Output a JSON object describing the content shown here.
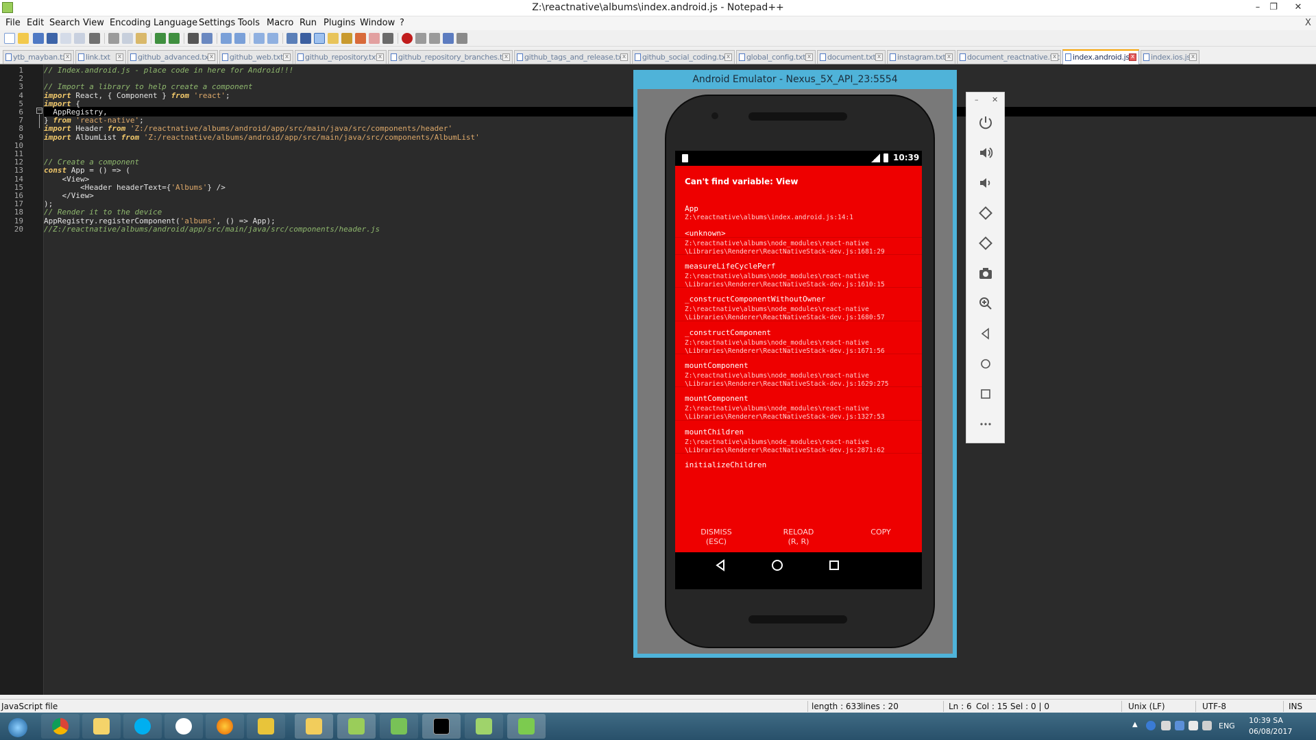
{
  "window": {
    "title": "Z:\\reactnative\\albums\\index.android.js - Notepad++"
  },
  "menu": [
    "File",
    "Edit",
    "Search",
    "View",
    "Encoding",
    "Language",
    "Settings",
    "Tools",
    "Macro",
    "Run",
    "Plugins",
    "Window",
    "?"
  ],
  "menu_close": "X",
  "tabs": [
    {
      "label": "ytb_mayban.txt",
      "active": false
    },
    {
      "label": "link.txt",
      "active": false
    },
    {
      "label": "github_advanced.txt",
      "active": false
    },
    {
      "label": "github_web.txt",
      "active": false
    },
    {
      "label": "github_repository.txt",
      "active": false
    },
    {
      "label": "github_repository_branches.txt",
      "active": false
    },
    {
      "label": "github_tags_and_release.txt",
      "active": false
    },
    {
      "label": "github_social_coding.txt",
      "active": false
    },
    {
      "label": "global_config.txt",
      "active": false
    },
    {
      "label": "document.txt",
      "active": false
    },
    {
      "label": "instagram.txt",
      "active": false
    },
    {
      "label": "document_reactnative.txt",
      "active": false
    },
    {
      "label": "index.android.js",
      "active": true
    },
    {
      "label": "index.ios.js",
      "active": false
    }
  ],
  "editor": {
    "current_line": 6,
    "lines": [
      [
        {
          "t": "// Index.android.js - place code in here for Android!!!",
          "c": "cmt"
        }
      ],
      [],
      [
        {
          "t": "// Import a library to help create a component",
          "c": "cmt"
        }
      ],
      [
        {
          "t": "import",
          "c": "kw"
        },
        {
          "t": " React, { Component } ",
          "c": "pl"
        },
        {
          "t": "from",
          "c": "kw"
        },
        {
          "t": " ",
          "c": "pl"
        },
        {
          "t": "'react'",
          "c": "str"
        },
        {
          "t": ";",
          "c": "pl"
        }
      ],
      [
        {
          "t": "import",
          "c": "kw"
        },
        {
          "t": " {",
          "c": "pl"
        }
      ],
      [
        {
          "t": "  AppRegistry,",
          "c": "pl"
        }
      ],
      [
        {
          "t": "} ",
          "c": "pl"
        },
        {
          "t": "from",
          "c": "kw"
        },
        {
          "t": " ",
          "c": "pl"
        },
        {
          "t": "'react-native'",
          "c": "str"
        },
        {
          "t": ";",
          "c": "pl"
        }
      ],
      [
        {
          "t": "import",
          "c": "kw"
        },
        {
          "t": " Header ",
          "c": "pl"
        },
        {
          "t": "from",
          "c": "kw"
        },
        {
          "t": " ",
          "c": "pl"
        },
        {
          "t": "'Z:/reactnative/albums/android/app/src/main/java/src/components/header'",
          "c": "str"
        }
      ],
      [
        {
          "t": "import",
          "c": "kw"
        },
        {
          "t": " AlbumList ",
          "c": "pl"
        },
        {
          "t": "from",
          "c": "kw"
        },
        {
          "t": " ",
          "c": "pl"
        },
        {
          "t": "'Z:/reactnative/albums/android/app/src/main/java/src/components/AlbumList'",
          "c": "str"
        }
      ],
      [],
      [],
      [
        {
          "t": "// Create a component",
          "c": "cmt"
        }
      ],
      [
        {
          "t": "const",
          "c": "kw"
        },
        {
          "t": " App = () => (",
          "c": "pl"
        }
      ],
      [
        {
          "t": "    <View>",
          "c": "pl"
        }
      ],
      [
        {
          "t": "        <Header headerText={",
          "c": "pl"
        },
        {
          "t": "'Albums'",
          "c": "str"
        },
        {
          "t": "} />",
          "c": "pl"
        }
      ],
      [
        {
          "t": "    </View>",
          "c": "pl"
        }
      ],
      [
        {
          "t": ");",
          "c": "pl"
        }
      ],
      [
        {
          "t": "// Render it to the device",
          "c": "cmt"
        }
      ],
      [
        {
          "t": "AppRegistry.registerComponent(",
          "c": "pl"
        },
        {
          "t": "'albums'",
          "c": "str"
        },
        {
          "t": ", () => App);",
          "c": "pl"
        }
      ],
      [
        {
          "t": "//Z:/reactnative/albums/android/app/src/main/java/src/components/header.js",
          "c": "cmt"
        }
      ]
    ]
  },
  "status": {
    "file_type": "JavaScript file",
    "length": "length : 633",
    "lines": "lines : 20",
    "ln": "Ln : 6",
    "col": "Col : 15",
    "sel": "Sel : 0 | 0",
    "eol": "Unix (LF)",
    "encoding": "UTF-8",
    "mode": "INS"
  },
  "emulator": {
    "title": "Android Emulator - Nexus_5X_API_23:5554",
    "clock": "10:39",
    "error_title": "Can't find variable: View",
    "frames": [
      {
        "fn": "App",
        "file": "Z:\\reactnative\\albums\\index.android.js:14:1"
      },
      {
        "fn": "<unknown>",
        "file": "Z:\\reactnative\\albums\\node_modules\\react-native\n\\Libraries\\Renderer\\ReactNativeStack-dev.js:1681:29"
      },
      {
        "fn": "measureLifeCyclePerf",
        "file": "Z:\\reactnative\\albums\\node_modules\\react-native\n\\Libraries\\Renderer\\ReactNativeStack-dev.js:1610:15"
      },
      {
        "fn": "_constructComponentWithoutOwner",
        "file": "Z:\\reactnative\\albums\\node_modules\\react-native\n\\Libraries\\Renderer\\ReactNativeStack-dev.js:1680:57"
      },
      {
        "fn": "_constructComponent",
        "file": "Z:\\reactnative\\albums\\node_modules\\react-native\n\\Libraries\\Renderer\\ReactNativeStack-dev.js:1671:56"
      },
      {
        "fn": "mountComponent",
        "file": "Z:\\reactnative\\albums\\node_modules\\react-native\n\\Libraries\\Renderer\\ReactNativeStack-dev.js:1629:275"
      },
      {
        "fn": "mountComponent",
        "file": "Z:\\reactnative\\albums\\node_modules\\react-native\n\\Libraries\\Renderer\\ReactNativeStack-dev.js:1327:53"
      },
      {
        "fn": "mountChildren",
        "file": "Z:\\reactnative\\albums\\node_modules\\react-native\n\\Libraries\\Renderer\\ReactNativeStack-dev.js:2871:62"
      },
      {
        "fn": "initializeChildren",
        "file": ""
      }
    ],
    "dismiss": "DISMISS\n(ESC)",
    "reload": "RELOAD\n(R, R)",
    "copy": "COPY"
  },
  "emulator_panel": {
    "icons": [
      "power-icon",
      "volume-up-icon",
      "volume-down-icon",
      "rotate-left-icon",
      "rotate-right-icon",
      "camera-icon",
      "zoom-icon",
      "back-icon",
      "home-icon",
      "overview-icon",
      "more-icon"
    ]
  },
  "taskbar": {
    "apps": [
      "start-orb",
      "chrome-icon",
      "file-manager-icon",
      "skype-icon",
      "zalo-icon",
      "firefox-icon",
      "app-icon",
      "folder-icon",
      "notepadpp-icon",
      "android-studio-icon",
      "cmd-icon",
      "android-sdk-icon",
      "emulator-icon"
    ],
    "lang": "ENG",
    "time": "10:39 SA",
    "date": "06/08/2017"
  },
  "colors": {
    "comment": "#8fb86e",
    "keyword": "#f2c96b",
    "string": "#dca86a",
    "plain": "#e4e4e4",
    "redbox": "#ee0000",
    "emulator_frame": "#4fb3d9"
  }
}
